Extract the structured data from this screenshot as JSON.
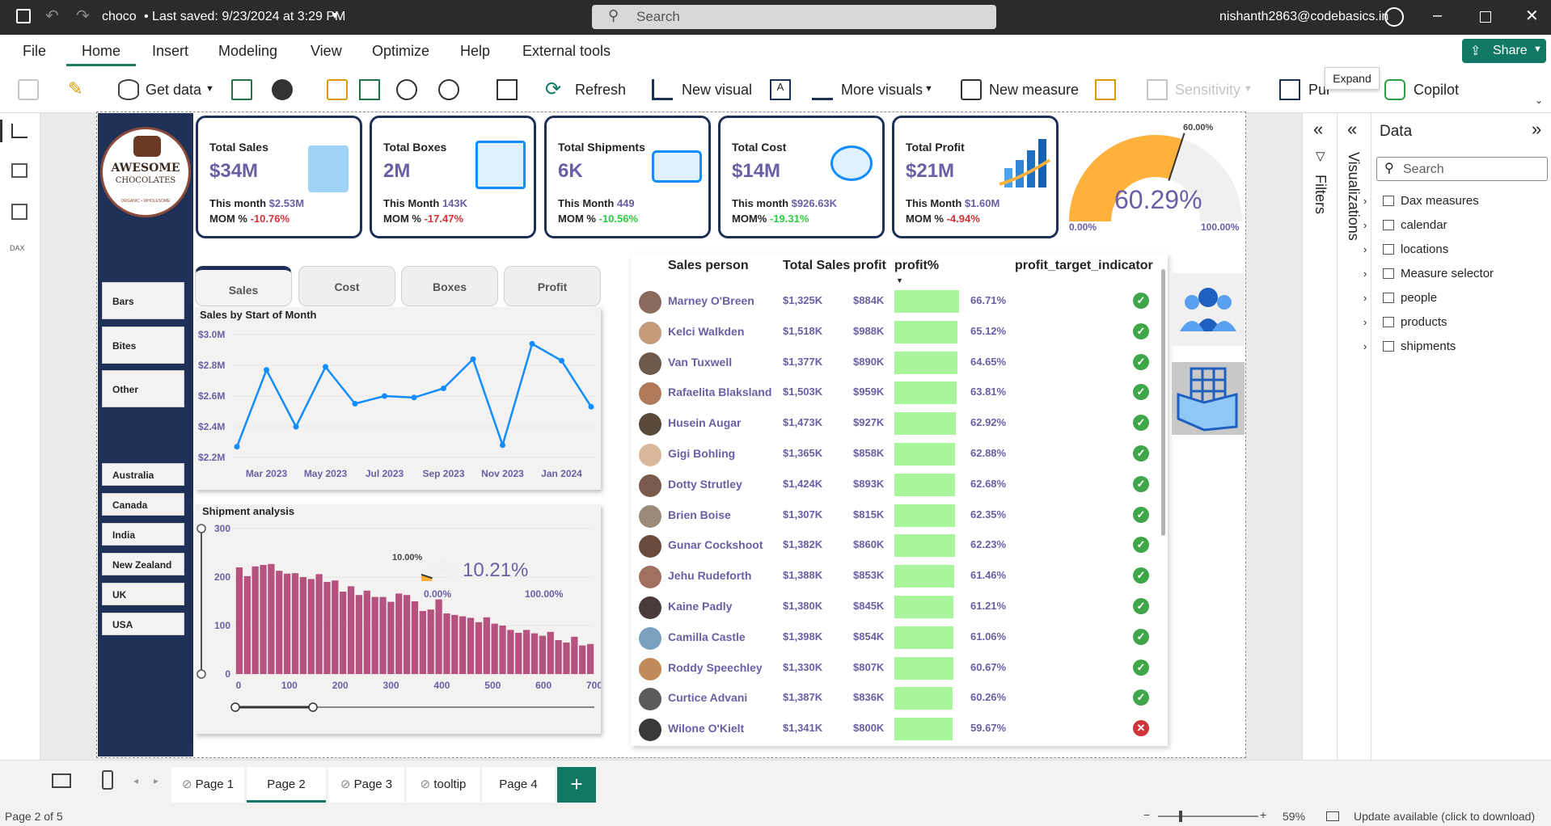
{
  "titlebar": {
    "file": "choco",
    "saved": "• Last saved: 9/23/2024 at 3:29 PM",
    "search": "Search",
    "user": "nishanth2863@codebasics.in"
  },
  "menu": [
    "File",
    "Home",
    "Insert",
    "Modeling",
    "View",
    "Optimize",
    "Help",
    "External tools"
  ],
  "share": "Share",
  "ribbon": {
    "get_data": "Get data",
    "refresh": "Refresh",
    "new_visual": "New visual",
    "more_visuals": "More visuals",
    "new_measure": "New measure",
    "sensitivity": "Sensitivity",
    "publish": "Pul",
    "copilot": "Copilot",
    "expand_tooltip": "Expand"
  },
  "brand": {
    "line1": "AWESOME",
    "line2": "CHOCOLATES",
    "tagline": "ORGANIC • WHOLESOME"
  },
  "kpis": [
    {
      "title": "Total Sales",
      "value": "$34M",
      "month_label": "This month",
      "month_value": "$2.53M",
      "mom_label": "MOM %",
      "mom_value": "-10.76%",
      "mom_sign": "neg"
    },
    {
      "title": "Total Boxes",
      "value": "2M",
      "month_label": "This Month",
      "month_value": "143K",
      "mom_label": "MOM %",
      "mom_value": "-17.47%",
      "mom_sign": "neg"
    },
    {
      "title": "Total Shipments",
      "value": "6K",
      "month_label": "This Month",
      "month_value": "449",
      "mom_label": "MOM %",
      "mom_value": "-10.56%",
      "mom_sign": "pos"
    },
    {
      "title": "Total Cost",
      "value": "$14M",
      "month_label": "This month",
      "month_value": "$926.63K",
      "mom_label": "MOM%",
      "mom_value": "-19.31%",
      "mom_sign": "pos"
    },
    {
      "title": "Total Profit",
      "value": "$21M",
      "month_label": "This Month",
      "month_value": "$1.60M",
      "mom_label": "MOM %",
      "mom_value": "-4.94%",
      "mom_sign": "neg"
    }
  ],
  "gauge_main": {
    "value": "60.29%",
    "fill": 0.6029,
    "target": "60.00%",
    "min": "0.00%",
    "max": "100.00%"
  },
  "slicers": {
    "product": [
      "Bars",
      "Bites",
      "Other"
    ],
    "country": [
      "Australia",
      "Canada",
      "India",
      "New Zealand",
      "UK",
      "USA"
    ]
  },
  "tabs": [
    "Sales",
    "Cost",
    "Boxes",
    "Profit"
  ],
  "chart_data": [
    {
      "type": "line",
      "title": "Sales by Start of Month",
      "x": [
        "Feb 2023",
        "Mar 2023",
        "Apr 2023",
        "May 2023",
        "Jun 2023",
        "Jul 2023",
        "Aug 2023",
        "Sep 2023",
        "Oct 2023",
        "Nov 2023",
        "Dec 2023",
        "Jan 2024",
        "Feb 2024"
      ],
      "values": [
        2.27,
        2.77,
        2.4,
        2.79,
        2.55,
        2.6,
        2.59,
        2.65,
        2.84,
        2.28,
        2.94,
        2.83,
        2.53
      ],
      "xticks": [
        "Mar 2023",
        "May 2023",
        "Jul 2023",
        "Sep 2023",
        "Nov 2023",
        "Jan 2024"
      ],
      "yticks": [
        "$2.2M",
        "$2.4M",
        "$2.6M",
        "$2.8M",
        "$3.0M"
      ],
      "ylim": [
        2.2,
        3.0
      ],
      "color": "#118dff"
    },
    {
      "type": "bar",
      "title": "Shipment analysis",
      "values": [
        220,
        202,
        222,
        225,
        227,
        213,
        207,
        208,
        200,
        196,
        206,
        190,
        193,
        170,
        181,
        163,
        172,
        159,
        159,
        149,
        166,
        163,
        150,
        130,
        133,
        154,
        125,
        122,
        119,
        116,
        107,
        117,
        104,
        100,
        91,
        85,
        91,
        84,
        79,
        87,
        70,
        65,
        77,
        59,
        62
      ],
      "xticks": [
        "0",
        "100",
        "200",
        "300",
        "400",
        "500",
        "600",
        "700"
      ],
      "yticks": [
        "0",
        "100",
        "200",
        "300"
      ],
      "ylim": [
        0,
        300
      ],
      "color": "#b5527d"
    }
  ],
  "gauge_small": {
    "value": "10.21%",
    "fill": 0.1021,
    "target": "10.00%",
    "min": "0.00%",
    "max": "100.00%"
  },
  "table": {
    "headers": [
      "Sales person",
      "Total Sales",
      "profit",
      "profit%",
      "profit_target_indicator"
    ],
    "rows": [
      {
        "name": "Marney O'Breen",
        "sales": "$1,325K",
        "profit": "$884K",
        "pct": "66.71%",
        "ok": true,
        "bar": 0.6671
      },
      {
        "name": "Kelci Walkden",
        "sales": "$1,518K",
        "profit": "$988K",
        "pct": "65.12%",
        "ok": true,
        "bar": 0.6512
      },
      {
        "name": "Van Tuxwell",
        "sales": "$1,377K",
        "profit": "$890K",
        "pct": "64.65%",
        "ok": true,
        "bar": 0.6465
      },
      {
        "name": "Rafaelita Blaksland",
        "sales": "$1,503K",
        "profit": "$959K",
        "pct": "63.81%",
        "ok": true,
        "bar": 0.6381
      },
      {
        "name": "Husein Augar",
        "sales": "$1,473K",
        "profit": "$927K",
        "pct": "62.92%",
        "ok": true,
        "bar": 0.6292
      },
      {
        "name": "Gigi Bohling",
        "sales": "$1,365K",
        "profit": "$858K",
        "pct": "62.88%",
        "ok": true,
        "bar": 0.6288
      },
      {
        "name": "Dotty Strutley",
        "sales": "$1,424K",
        "profit": "$893K",
        "pct": "62.68%",
        "ok": true,
        "bar": 0.6268
      },
      {
        "name": "Brien Boise",
        "sales": "$1,307K",
        "profit": "$815K",
        "pct": "62.35%",
        "ok": true,
        "bar": 0.6235
      },
      {
        "name": "Gunar Cockshoot",
        "sales": "$1,382K",
        "profit": "$860K",
        "pct": "62.23%",
        "ok": true,
        "bar": 0.6223
      },
      {
        "name": "Jehu Rudeforth",
        "sales": "$1,388K",
        "profit": "$853K",
        "pct": "61.46%",
        "ok": true,
        "bar": 0.6146
      },
      {
        "name": "Kaine Padly",
        "sales": "$1,380K",
        "profit": "$845K",
        "pct": "61.21%",
        "ok": true,
        "bar": 0.6121
      },
      {
        "name": "Camilla Castle",
        "sales": "$1,398K",
        "profit": "$854K",
        "pct": "61.06%",
        "ok": true,
        "bar": 0.6106
      },
      {
        "name": "Roddy Speechley",
        "sales": "$1,330K",
        "profit": "$807K",
        "pct": "60.67%",
        "ok": true,
        "bar": 0.6067
      },
      {
        "name": "Curtice Advani",
        "sales": "$1,387K",
        "profit": "$836K",
        "pct": "60.26%",
        "ok": true,
        "bar": 0.6026
      },
      {
        "name": "Wilone O'Kielt",
        "sales": "$1,341K",
        "profit": "$800K",
        "pct": "59.67%",
        "ok": false,
        "bar": 0.5967
      }
    ]
  },
  "panes": {
    "filters": "Filters",
    "visualizations": "Visualizations",
    "data": "Data",
    "search": "Search",
    "tree": [
      "Dax measures",
      "calendar",
      "locations",
      "Measure selector",
      "people",
      "products",
      "shipments"
    ]
  },
  "pages": [
    "Page 1",
    "Page 2",
    "Page 3",
    "tooltip",
    "Page 4"
  ],
  "status": {
    "page": "Page 2 of 5",
    "zoom": "59%",
    "update": "Update available (click to download)"
  },
  "colors": {
    "navy": "#1f3057",
    "accent": "#6a5ea5",
    "gauge": "#ffb13b",
    "line": "#118dff",
    "bars": "#b5527d",
    "ok": "#3fa64a",
    "bad": "#d13438"
  }
}
